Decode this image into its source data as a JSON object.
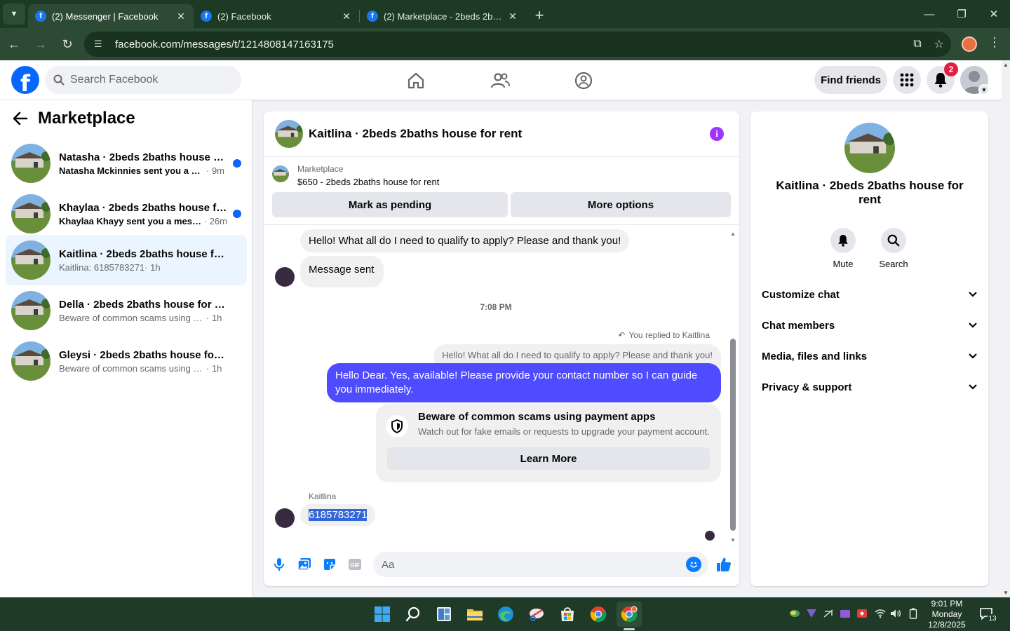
{
  "browser": {
    "tabs": [
      {
        "label": "(2) Messenger | Facebook",
        "active": true
      },
      {
        "label": "(2) Facebook",
        "active": false
      },
      {
        "label": "(2) Marketplace - 2beds 2baths",
        "active": false
      }
    ],
    "url": "facebook.com/messages/t/1214808147163175"
  },
  "fb_header": {
    "search_placeholder": "Search Facebook",
    "find_friends_label": "Find friends",
    "notification_count": "2"
  },
  "sidebar": {
    "title": "Marketplace",
    "conversations": [
      {
        "name": "Natasha · 2beds 2baths house for rent",
        "snippet": "Natasha Mckinnies sent you a message",
        "time": "· 9m",
        "unread": true
      },
      {
        "name": "Khaylaa · 2beds 2baths house for rent",
        "snippet": "Khaylaa Khayy sent you a message",
        "time": "· 26m",
        "unread": true
      },
      {
        "name": "Kaitlina · 2beds 2baths house for rent",
        "snippet": "Kaitlina: 6185783271",
        "time": "· 1h",
        "unread": false,
        "active": true
      },
      {
        "name": "Della · 2beds 2baths house for rent",
        "snippet": "Beware of common scams using payment apps",
        "time": "· 1h",
        "unread": false
      },
      {
        "name": "Gleysi · 2beds 2baths house for rent",
        "snippet": "Beware of common scams using payment apps",
        "time": "· 1h",
        "unread": false
      }
    ]
  },
  "chat": {
    "title": "Kaitlina · 2beds 2baths house for rent",
    "marketplace_label": "Marketplace",
    "listing": "$650 - 2beds 2baths house for rent",
    "mark_pending_label": "Mark as pending",
    "more_options_label": "More options",
    "messages": {
      "incoming_1": "Hello! What all do I need to qualify to apply? Please and thank you!",
      "incoming_2": "Message sent",
      "time_separator": "7:08 PM",
      "replied_label": "You replied to Kaitlina",
      "quoted": "Hello! What all do I need to qualify to apply? Please and thank you!",
      "outgoing": "Hello Dear. Yes, available! Please provide your contact number so I can guide you immediately.",
      "scam_title": "Beware of common scams using payment apps",
      "scam_desc": "Watch out for fake emails or requests to upgrade your payment account.",
      "learn_more_label": "Learn More",
      "sender_name": "Kaitlina",
      "incoming_3": "6185783271"
    },
    "composer_placeholder": "Aa"
  },
  "right_panel": {
    "name": "Kaitlina · 2beds 2baths house for rent",
    "actions": [
      {
        "label": "Mute",
        "icon": "bell-icon"
      },
      {
        "label": "Search",
        "icon": "search-icon"
      }
    ],
    "sections": [
      "Customize chat",
      "Chat members",
      "Media, files and links",
      "Privacy & support"
    ]
  },
  "taskbar": {
    "time": "9:01 PM",
    "day": "Monday",
    "date": "12/8/2025",
    "notification_count": "13"
  },
  "colors": {
    "fb_blue": "#0866ff",
    "outgoing_bubble": "#4f4bff",
    "info_purple": "#a033ff",
    "badge_red": "#e41e3f"
  }
}
